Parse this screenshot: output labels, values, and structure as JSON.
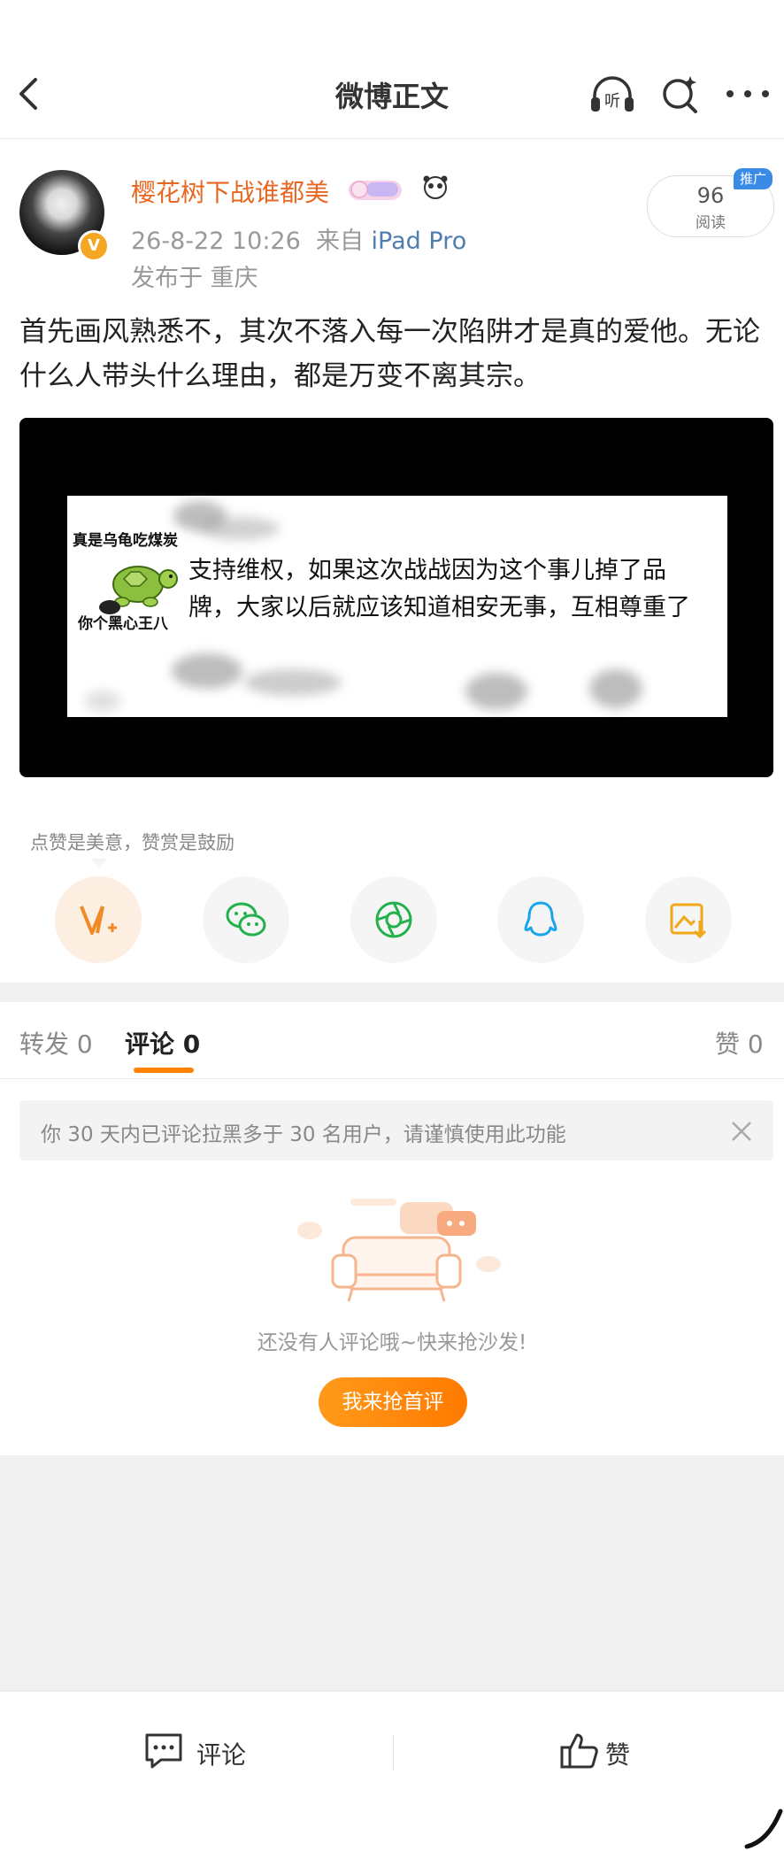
{
  "header": {
    "title": "微博正文"
  },
  "post": {
    "author": "樱花树下战谁都美",
    "verified_badge": "V",
    "timestamp": "26-8-22 10:26",
    "source_prefix": "来自",
    "source": "iPad Pro",
    "location": "发布于 重庆",
    "read_count": "96",
    "read_label": "阅读",
    "promo_tag": "推广",
    "text": "首先画风熟悉不，其次不落入每一次陷阱才是真的爱他。无论什么人带头什么理由，都是万变不离其宗。",
    "image": {
      "sticker_top": "真是乌龟吃煤炭",
      "sticker_bottom": "你个黑心王八",
      "quote": "支持维权，如果这次战战因为这个事儿掉了品牌，大家以后就应该知道相安无事，互相尊重了"
    }
  },
  "share": {
    "hint": "点赞是美意，赞赏是鼓励",
    "icons": [
      "reward-v-icon",
      "wechat-icon",
      "moments-icon",
      "qq-icon",
      "save-image-icon"
    ]
  },
  "tabs": {
    "repost": "转发 0",
    "comment": "评论 0",
    "like": "赞 0"
  },
  "notice": "你 30 天内已评论拉黑多于 30 名用户，请谨慎使用此功能",
  "empty": {
    "text": "还没有人评论哦~快来抢沙发!",
    "button": "我来抢首评"
  },
  "bottom_bar": {
    "comment": "评论",
    "like": "赞"
  },
  "colors": {
    "accent": "#ff8200",
    "username": "#e86722",
    "link": "#507daf",
    "promo": "#3a8be8"
  }
}
